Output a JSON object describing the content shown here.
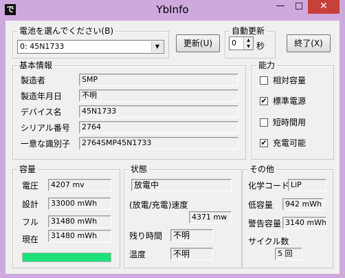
{
  "window": {
    "title": "YbInfo",
    "app_icon_text": "で",
    "minimize": "—",
    "maximize": "□",
    "close": "✕"
  },
  "battery_select": {
    "label": "電池を選んでください(B)",
    "value": "0: 45N1733"
  },
  "update_button": "更新(U)",
  "auto_update": {
    "label": "自動更新",
    "value": "0",
    "unit": "秒"
  },
  "exit_button": "終了(X)",
  "basic_info": {
    "title": "基本情報",
    "rows": [
      {
        "label": "製造者",
        "value": "SMP"
      },
      {
        "label": "製造年月日",
        "value": "不明"
      },
      {
        "label": "デバイス名",
        "value": "45N1733"
      },
      {
        "label": "シリアル番号",
        "value": "2764"
      },
      {
        "label": "一意な識別子",
        "value": "2764SMP45N1733"
      }
    ]
  },
  "capability": {
    "title": "能力",
    "items": [
      {
        "label": "相対容量",
        "checked": false,
        "mark": ""
      },
      {
        "label": "標準電源",
        "checked": true,
        "mark": "✔"
      },
      {
        "label": "短時間用",
        "checked": false,
        "mark": ""
      },
      {
        "label": "充電可能",
        "checked": true,
        "mark": "✔"
      }
    ]
  },
  "capacity": {
    "title": "容量",
    "rows": [
      {
        "label": "電圧",
        "value": "4207 mv"
      },
      {
        "label": "設計",
        "value": "33000 mWh"
      },
      {
        "label": "フル",
        "value": "31480 mWh"
      },
      {
        "label": "現在",
        "value": "31480 mWh"
      }
    ],
    "progress": 1.0
  },
  "state": {
    "title": "状態",
    "status": "放電中",
    "rate_label": "(放電/充電)速度",
    "rate_value": "4371 mw",
    "remaining_label": "残り時間",
    "remaining_value": "不明",
    "temp_label": "温度",
    "temp_value": "不明"
  },
  "other": {
    "title": "その他",
    "chemistry_label": "化学コード",
    "chemistry_value": "LiP",
    "low_label": "低容量",
    "low_value": "942 mWh",
    "warn_label": "警告容量",
    "warn_value": "3140 mWh",
    "cycle_label": "サイクル数",
    "cycle_value": "5 回"
  },
  "colors": {
    "title_bar": "#cea9de",
    "close_button": "#c7403a",
    "progress_fill": "#1ee07a"
  }
}
